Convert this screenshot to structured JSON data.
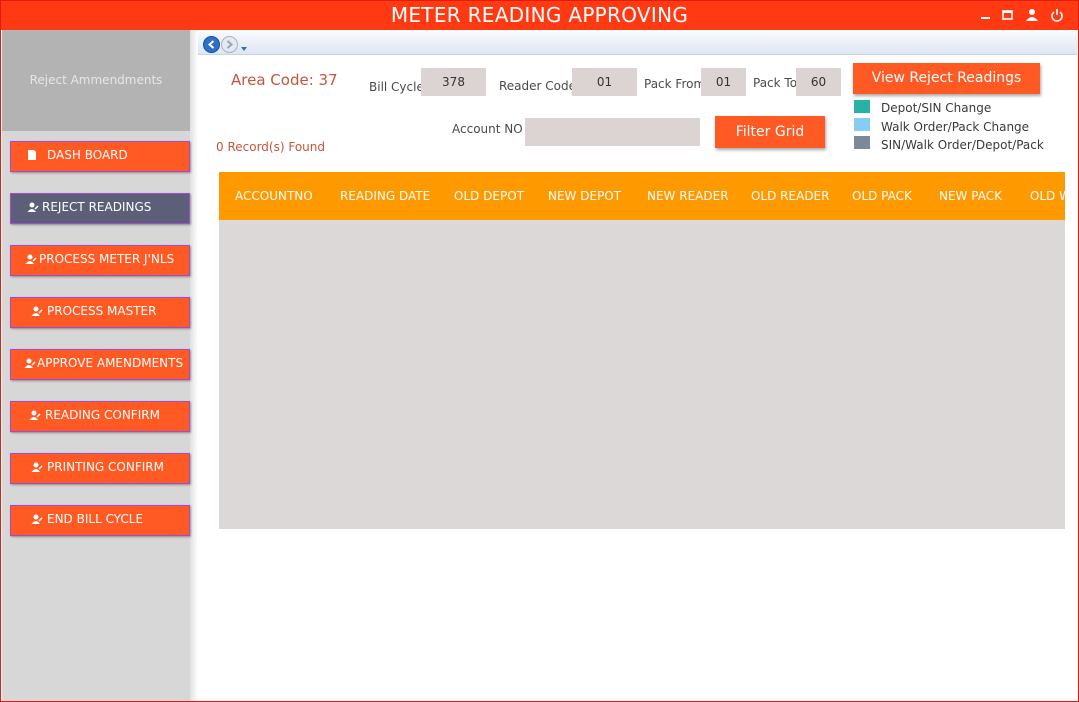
{
  "window": {
    "title": "METER READING APPROVING"
  },
  "sidebar": {
    "header": "Reject Ammendments",
    "items": [
      {
        "label": "DASH BOARD",
        "icon": "document-icon"
      },
      {
        "label": "REJECT READINGS",
        "icon": "user-edit-icon",
        "active": true
      },
      {
        "label": "PROCESS METER J'NLS",
        "icon": "user-edit-icon"
      },
      {
        "label": "PROCESS MASTER",
        "icon": "user-edit-icon"
      },
      {
        "label": "APPROVE AMENDMENTS",
        "icon": "user-edit-icon"
      },
      {
        "label": "READING CONFIRM",
        "icon": "user-edit-icon"
      },
      {
        "label": "PRINTING CONFIRM",
        "icon": "user-edit-icon"
      },
      {
        "label": "END BILL CYCLE",
        "icon": "user-edit-icon"
      }
    ]
  },
  "filters": {
    "area_code": "Area Code: 37",
    "bill_cycle_label": "Bill Cycle",
    "bill_cycle_value": "378",
    "reader_code_label": "Reader Code",
    "reader_code_value": "01",
    "pack_from_label": "Pack From",
    "pack_from_value": "01",
    "pack_to_label": "Pack To",
    "pack_to_value": "60",
    "account_no_label": "Account NO",
    "account_no_value": "",
    "records_found": "0 Record(s) Found",
    "view_button": "View Reject Readings",
    "filter_button": "Filter Grid"
  },
  "legend": [
    {
      "label": "Depot/SIN Change",
      "color": "#26b3a6"
    },
    {
      "label": "Walk Order/Pack Change",
      "color": "#86cdf3"
    },
    {
      "label": "SIN/Walk Order/Depot/Pack",
      "color": "#7a8a9a"
    }
  ],
  "grid": {
    "columns": [
      "ACCOUNTNO",
      "READING DATE",
      "OLD DEPOT",
      "NEW DEPOT",
      "NEW READER",
      "OLD READER",
      "OLD PACK",
      "NEW PACK",
      "OLD WALK ORDER"
    ],
    "rows": []
  },
  "colors": {
    "accent": "#ff5a24",
    "titlebar": "#ff3a12",
    "grid_header": "#ff9900",
    "active_nav": "#5c5f78"
  }
}
